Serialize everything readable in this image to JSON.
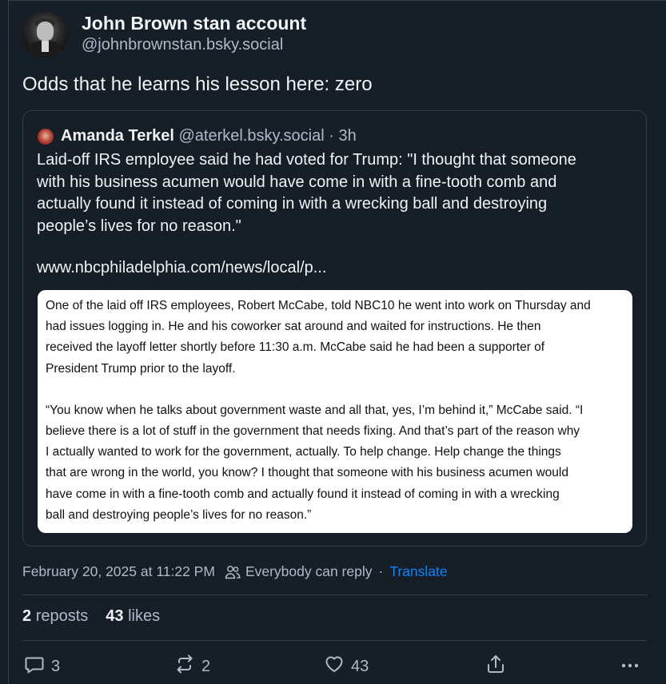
{
  "author": {
    "display_name": "John Brown stan account",
    "handle": "@johnbrownstan.bsky.social",
    "avatar_icon": "portrait-avatar"
  },
  "post": {
    "text": "Odds that he learns his lesson here: zero"
  },
  "quoted_post": {
    "author_name": "Amanda Terkel",
    "author_handle": "@aterkel.bsky.social",
    "separator": "·",
    "age": "3h",
    "text_lines": [
      "Laid-off IRS employee said he had voted for Trump: \"I thought that someone",
      "with his business acumen would have come in with a fine-tooth comb and",
      "actually found it instead of coming in with a wrecking ball and destroying",
      "people’s lives for no reason.\""
    ],
    "link": "www.nbcphiladelphia.com/news/local/p...",
    "article_paragraph_1": [
      "One of the laid off IRS employees, Robert McCabe, told NBC10 he went into work on Thursday and",
      "had issues logging in. He and his coworker sat around and waited for instructions. He then",
      "received the layoff letter shortly before 11:30 a.m. McCabe said he had been a supporter of",
      "President Trump prior to the layoff."
    ],
    "article_paragraph_2": [
      "“You know when he talks about government waste and all that, yes, I’m behind it,” McCabe said. “I",
      "believe there is a lot of stuff in the government that needs fixing. And that’s part of the reason why",
      "I actually wanted to work for the government, actually. To help change. Help change the things",
      "that are wrong in the world, you know? I thought that someone with his business acumen would",
      "have come in with a fine-tooth comb and actually found it instead of coming in with a wrecking",
      "ball and destroying people’s lives for no reason.”"
    ]
  },
  "meta": {
    "timestamp": "February 20, 2025 at 11:22 PM",
    "reply_setting": "Everybody can reply",
    "separator": "·",
    "translate_label": "Translate",
    "accent_color": "#1083fe"
  },
  "stats": {
    "reposts_count": "2",
    "reposts_label": "reposts",
    "likes_count": "43",
    "likes_label": "likes"
  },
  "actions": {
    "reply_count": "3",
    "repost_count": "2",
    "like_count": "43",
    "icons": [
      "reply-icon",
      "repost-icon",
      "like-icon",
      "share-icon",
      "more-icon"
    ]
  }
}
